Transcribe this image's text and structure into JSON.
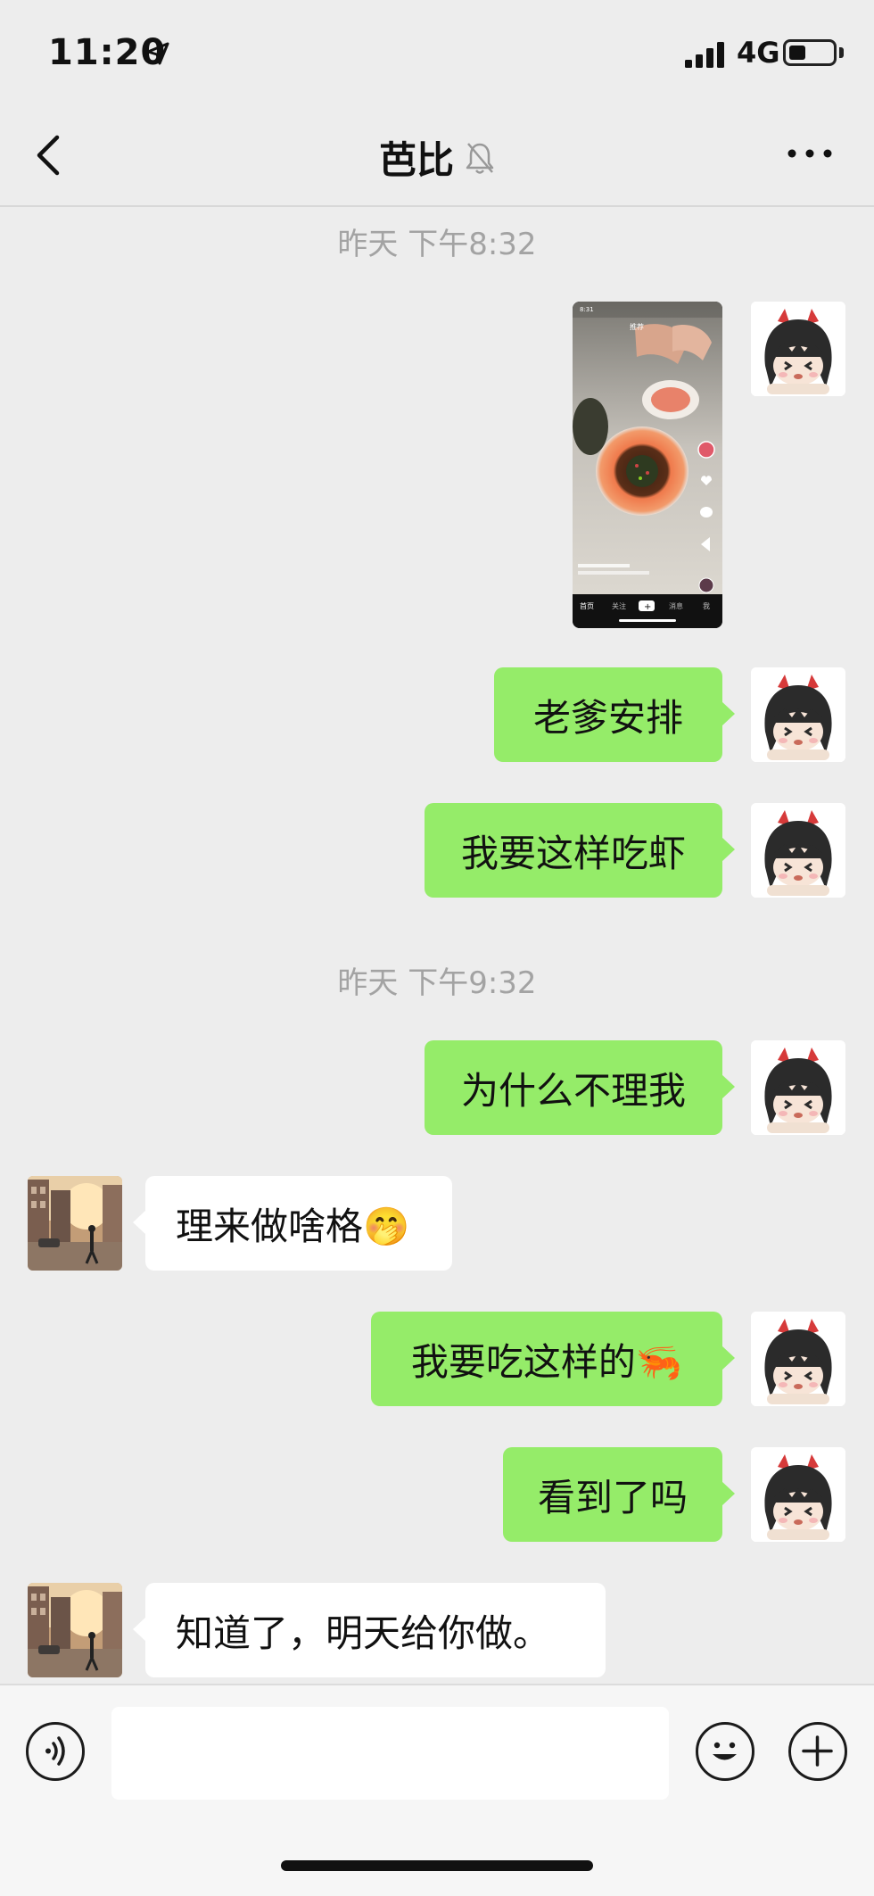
{
  "status_bar": {
    "time": "11:20",
    "network": "4G"
  },
  "nav": {
    "title": "芭比"
  },
  "messages": {
    "ts1": "昨天 下午8:32",
    "m1": "老爹安排",
    "m2": "我要这样吃虾",
    "ts2": "昨天 下午9:32",
    "m3": "为什么不理我",
    "m4": "理来做啥格🤭",
    "m5": "我要吃这样的🦐",
    "m6": "看到了吗",
    "m7": "知道了，明天给你做。"
  },
  "video": {
    "status_time": "8:31",
    "tabs": [
      "首页",
      "关注",
      "+",
      "消息",
      "我"
    ],
    "top_tabs": [
      "推荐"
    ]
  },
  "input": {
    "value": ""
  },
  "colors": {
    "bubble_me": "#95ec69",
    "bubble_other": "#ffffff",
    "background": "#ededed"
  }
}
